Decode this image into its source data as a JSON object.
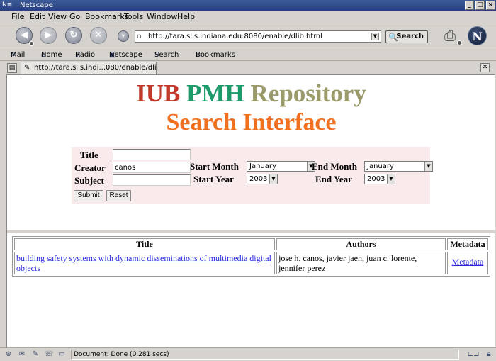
{
  "window": {
    "title": "Netscape"
  },
  "menu": [
    "File",
    "Edit",
    "View",
    "Go",
    "Bookmarks",
    "Tools",
    "Window",
    "Help"
  ],
  "navigation": {
    "url": "http://tara.slis.indiana.edu:8080/enable/dlib.html",
    "search_label": "Search"
  },
  "personal_toolbar": [
    "Mail",
    "Home",
    "Radio",
    "Netscape",
    "Search",
    "Bookmarks"
  ],
  "tab": {
    "label": "http://tara.slis.indi...080/enable/dlib.html"
  },
  "page": {
    "heading_line1": [
      "IUB",
      "PMH",
      "Repository"
    ],
    "heading_line2": "Search Interface",
    "form": {
      "title_label": "Title",
      "title_value": "",
      "creator_label": "Creator",
      "creator_value": "canos",
      "subject_label": "Subject",
      "subject_value": "",
      "start_month_label": "Start Month",
      "start_month_value": "January",
      "end_month_label": "End Month",
      "end_month_value": "January",
      "start_year_label": "Start Year",
      "start_year_value": "2003",
      "end_year_label": "End Year",
      "end_year_value": "2003",
      "submit_label": "Submit",
      "reset_label": "Reset"
    },
    "results": {
      "headers": [
        "Title",
        "Authors",
        "Metadata"
      ],
      "rows": [
        {
          "title": "building safety systems with dynamic disseminations of multimedia digital objects",
          "authors": "jose h. canos, javier jaen, juan c. lorente, jennifer perez",
          "metadata": "Metadata"
        }
      ]
    }
  },
  "status": {
    "text": "Document: Done (0.281 secs)"
  }
}
